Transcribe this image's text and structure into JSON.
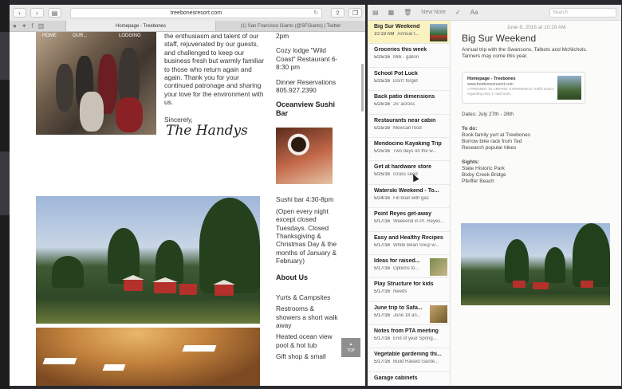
{
  "safari": {
    "url": "treebonesresort.com",
    "tabs": [
      "Homepage - Treebones",
      "(1) San Francisco Giants (@SFGiants) | Twitter"
    ],
    "site_nav": [
      "HOME",
      "OUR...",
      "LODGING"
    ],
    "intro_text": "the enthusiasm and talent of our staff, rejuvenated by our guests, and challenged to keep our business fresh but warmly familiar to those who return again and again. Thank you for your continued patronage and sharing your love for the environment with us.",
    "sincerely": "Sincerely,",
    "signature": "The Handys",
    "col3_top": [
      "2pm",
      "Cozy lodge \"Wild Coast\" Restaurant 6-8:30 pm",
      "Dinner Reservations 805.927.2390"
    ],
    "sushi_heading": "Oceanview Sushi Bar",
    "sushi_hours": "Sushi bar 4:30-8pm",
    "sushi_note": "(Open every night except closed Tuesdays. Closed Thanksgiving & Christmas Day & the months of January & February)",
    "about_heading": "About Us",
    "about_items": [
      "Yurts & Campsites",
      "Restrooms & showers a short walk away",
      "Heated ocean view pool & hot tub",
      "Gift shop & small"
    ],
    "totop": "TOP"
  },
  "notes": {
    "toolbar": {
      "new_note": "New Note",
      "search_placeholder": "Search"
    },
    "items": [
      {
        "title": "Big Sur Weekend",
        "date": "10:19 AM",
        "snippet": "Annual t..."
      },
      {
        "title": "Groceries this week",
        "date": "5/25/16",
        "snippet": "Milk - gallon"
      },
      {
        "title": "School Pot Luck",
        "date": "5/25/16",
        "snippet": "Don't forget"
      },
      {
        "title": "Back patio dimensions",
        "date": "5/25/16",
        "snippet": "25' across"
      },
      {
        "title": "Restaurants near cabin",
        "date": "5/25/16",
        "snippet": "Mexican food"
      },
      {
        "title": "Mendocino Kayaking Trip",
        "date": "5/25/16",
        "snippet": "Two days on the w..."
      },
      {
        "title": "Get at hardware store",
        "date": "5/25/16",
        "snippet": "Grass seed"
      },
      {
        "title": "Waterski Weekend - To...",
        "date": "5/24/16",
        "snippet": "Fill boat with gas"
      },
      {
        "title": "Point Reyes get-away",
        "date": "5/17/16",
        "snippet": "Weekend in Pt. Reyes..."
      },
      {
        "title": "Easy and Healthy Recipes",
        "date": "5/17/16",
        "snippet": "White Bean Soup w..."
      },
      {
        "title": "Ideas for raised...",
        "date": "5/17/16",
        "snippet": "Options fo..."
      },
      {
        "title": "Play Structure for kids",
        "date": "5/17/16",
        "snippet": "Needs"
      },
      {
        "title": "June trip to Safa...",
        "date": "5/17/16",
        "snippet": "June 18 an..."
      },
      {
        "title": "Notes from PTA meeting",
        "date": "5/17/16",
        "snippet": "End of year Spring..."
      },
      {
        "title": "Vegetable gardening thi...",
        "date": "5/17/16",
        "snippet": "Build Raised Garde..."
      },
      {
        "title": "Garage cabinets",
        "date": "",
        "snippet": ""
      }
    ],
    "detail": {
      "timestamp": "June 8, 2016 at 10:19 AM",
      "title": "Big Sur Weekend",
      "intro": "Annual trip with the Swansons, Talbots and McNichols. Tanners may come this year.",
      "link_title": "Homepage - Treebones",
      "link_url": "www.treebonesresort.com",
      "link_snippet": "A PREMIER 'GLAMPING' EXPERIENCE Traffic Notice regarding Hwy 1 road work...",
      "dates": "Dates: July 27th - 28th",
      "todo_heading": "To do:",
      "todo": [
        "Book family yurt at Treebones",
        "Borrow bike rack from Ted",
        "Research popular hikes"
      ],
      "sights_heading": "Sights:",
      "sights": [
        "State Historic Park",
        "Bixby Creek Bridge",
        "Pfeiffer Beach"
      ]
    }
  }
}
